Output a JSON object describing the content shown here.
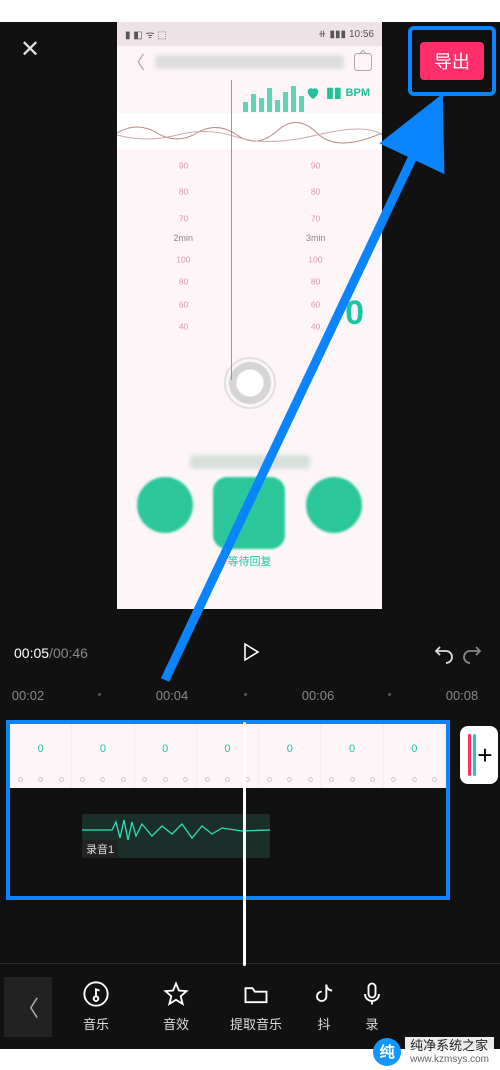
{
  "header": {
    "export_label": "导出"
  },
  "preview": {
    "status_time": "10:56",
    "bpm_label": "BPM",
    "ticks_a": [
      "90",
      "80",
      "70"
    ],
    "time_labels": [
      "2min",
      "3min"
    ],
    "ticks_b": [
      "100",
      "80",
      "60",
      "40"
    ],
    "big_value": "0",
    "footer_text": "等待回复"
  },
  "playbar": {
    "current": "00:05",
    "total": "00:46"
  },
  "ruler": {
    "marks": [
      "00:02",
      "00:04",
      "00:06",
      "00:08"
    ]
  },
  "timeline": {
    "audio_clip_label": "录音1",
    "add_label": "+"
  },
  "toolbar": {
    "items": [
      {
        "key": "music",
        "label": "音乐"
      },
      {
        "key": "sfx",
        "label": "音效"
      },
      {
        "key": "extract",
        "label": "提取音乐"
      },
      {
        "key": "douyin",
        "label": "抖"
      },
      {
        "key": "mic",
        "label": "录"
      }
    ]
  },
  "watermark": {
    "brand": "纯净系统之家",
    "url": "www.kzmsys.com"
  }
}
